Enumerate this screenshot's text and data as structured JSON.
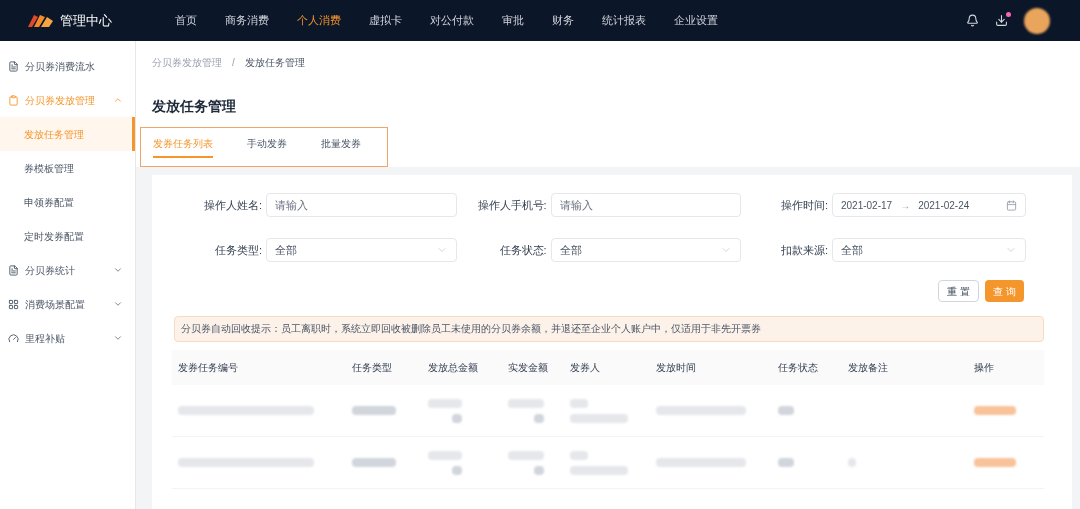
{
  "brand": {
    "name": "管理中心"
  },
  "nav": [
    {
      "label": "首页",
      "selected": false
    },
    {
      "label": "商务消费",
      "selected": false
    },
    {
      "label": "个人消费",
      "selected": true
    },
    {
      "label": "虚拟卡",
      "selected": false
    },
    {
      "label": "对公付款",
      "selected": false
    },
    {
      "label": "审批",
      "selected": false
    },
    {
      "label": "财务",
      "selected": false
    },
    {
      "label": "统计报表",
      "selected": false
    },
    {
      "label": "企业设置",
      "selected": false
    }
  ],
  "header": {
    "download_badge": true
  },
  "sidebar": {
    "items": [
      {
        "label": "分贝券消费流水",
        "selected": false
      },
      {
        "label": "分贝券发放管理",
        "selected": false,
        "expanded": true,
        "children": [
          {
            "label": "发放任务管理",
            "selected": true
          },
          {
            "label": "券模板管理",
            "selected": false
          },
          {
            "label": "申领券配置",
            "selected": false
          },
          {
            "label": "定时发券配置",
            "selected": false
          }
        ]
      },
      {
        "label": "分贝券统计",
        "selected": false,
        "expanded": false
      },
      {
        "label": "消费场景配置",
        "selected": false,
        "expanded": false
      },
      {
        "label": "里程补贴",
        "selected": false,
        "expanded": false
      }
    ]
  },
  "breadcrumb": {
    "items": [
      "分贝券发放管理",
      "发放任务管理"
    ],
    "separator": "/"
  },
  "page_title": "发放任务管理",
  "tabs": [
    {
      "label": "发券任务列表",
      "selected": true
    },
    {
      "label": "手动发券",
      "selected": false
    },
    {
      "label": "批量发券",
      "selected": false
    }
  ],
  "filters": [
    {
      "kind": "text",
      "label": "操作人姓名:",
      "placeholder": "请输入"
    },
    {
      "kind": "text",
      "label": "操作人手机号:",
      "placeholder": "请输入"
    },
    {
      "kind": "daterange",
      "label": "操作时间:",
      "start": "2021-02-17",
      "separator": "→",
      "end": "2021-02-24"
    },
    {
      "kind": "select",
      "label": "任务类型:",
      "value": "全部"
    },
    {
      "kind": "select",
      "label": "任务状态:",
      "value": "全部"
    },
    {
      "kind": "select",
      "label": "扣款来源:",
      "value": "全部"
    }
  ],
  "buttons": [
    {
      "label": "重 置",
      "kind": "default"
    },
    {
      "label": "查 询",
      "kind": "primary"
    }
  ],
  "notice": "分贝券自动回收提示：员工离职时，系统立即回收被删除员工未使用的分贝券余额，并退还至企业个人账户中，仅适用于非先开票券",
  "table": {
    "columns": [
      "发券任务编号",
      "任务类型",
      "发放总金额",
      "实发金额",
      "发券人",
      "发放时间",
      "任务状态",
      "发放备注",
      "操作"
    ]
  }
}
